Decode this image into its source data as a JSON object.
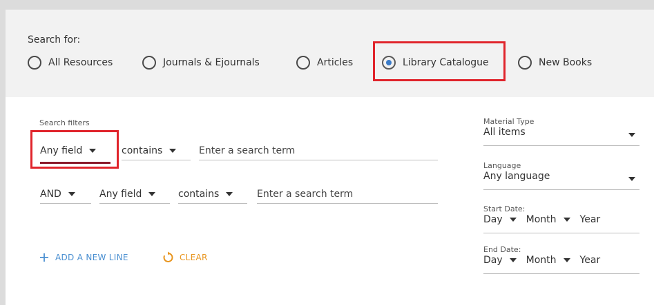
{
  "search_scope": {
    "title": "Search for:",
    "options": [
      {
        "label": "All Resources",
        "selected": false
      },
      {
        "label": "Journals & Ejournals",
        "selected": false
      },
      {
        "label": "Articles",
        "selected": false
      },
      {
        "label": "Library Catalogue",
        "selected": true
      },
      {
        "label": "New Books",
        "selected": false
      }
    ]
  },
  "filters": {
    "title": "Search filters",
    "rows": [
      {
        "operator": null,
        "field": "Any field",
        "condition": "contains",
        "placeholder": "Enter a search term"
      },
      {
        "operator": "AND",
        "field": "Any field",
        "condition": "contains",
        "placeholder": "Enter a search term"
      }
    ],
    "add_line_label": "ADD A NEW LINE",
    "clear_label": "CLEAR"
  },
  "side_filters": {
    "material_type": {
      "label": "Material Type",
      "value": "All items"
    },
    "language": {
      "label": "Language",
      "value": "Any language"
    },
    "start_date": {
      "label": "Start Date:",
      "day": "Day",
      "month": "Month",
      "year": "Year"
    },
    "end_date": {
      "label": "End Date:",
      "day": "Day",
      "month": "Month",
      "year": "Year"
    }
  },
  "colors": {
    "highlight": "#e0242b",
    "radio_selected": "#3a7bc8",
    "add_action": "#4a8fd1",
    "clear_action": "#e8951e",
    "field_underline": "#8b1a2b"
  },
  "icons": [
    "plus-icon",
    "refresh-icon",
    "caret-down-icon"
  ]
}
